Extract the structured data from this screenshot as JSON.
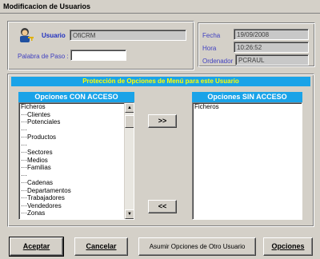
{
  "window": {
    "title": "Modificacion de Usuarios"
  },
  "user": {
    "usuario_label": "Usuario",
    "usuario_value": "OfiCRM",
    "password_label": "Palabra de Paso :",
    "password_value": ""
  },
  "info": {
    "fecha_label": "Fecha",
    "fecha_value": "19/09/2008",
    "hora_label": "Hora",
    "hora_value": "10:26:52",
    "ordenador_label": "Ordenador",
    "ordenador_value": "PCRAUL"
  },
  "permissions": {
    "banner": "Protección de Opciones de Menú para este Usuario",
    "with_access_header": "Opciones CON ACCESO",
    "without_access_header": "Opciones SIN ACCESO",
    "with_access_items": [
      "Ficheros",
      "···Clientes",
      "···Potenciales",
      "···",
      "···Productos",
      "···",
      "···Sectores",
      "···Medios",
      "···Familias",
      "···",
      "···Cadenas",
      "···Departamentos",
      "···Trabajadores",
      "···Vendedores",
      "···Zonas"
    ],
    "without_access_items": [
      "Ficheros"
    ],
    "move_right_label": ">>",
    "move_left_label": "<<"
  },
  "buttons": {
    "accept": "Aceptar",
    "cancel": "Cancelar",
    "assign_other": "Asumir Opciones de Otro Usuario",
    "options": "Opciones"
  },
  "colors": {
    "header_blue": "#1aa3e8",
    "banner_text": "#ffff00",
    "label_blue": "#4040c0"
  }
}
